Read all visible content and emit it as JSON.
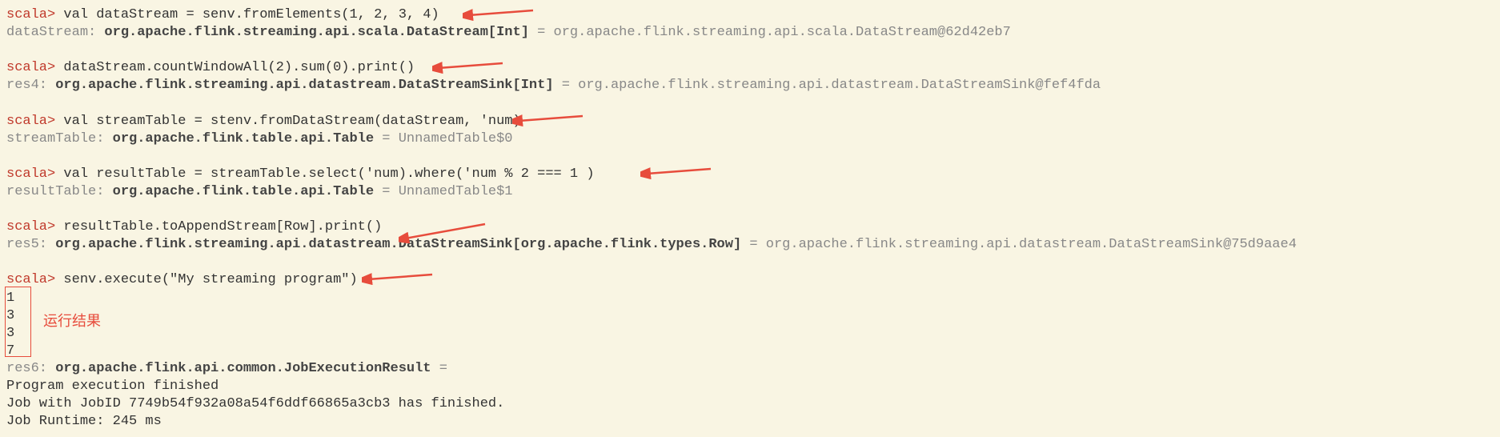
{
  "prompt": "scala>",
  "lines": {
    "l1_cmd": " val dataStream = senv.fromElements(1, 2, 3, 4)",
    "l2_var": "dataStream: ",
    "l2_type": "org.apache.flink.streaming.api.scala.DataStream[Int]",
    "l2_eq": " = ",
    "l2_val": "org.apache.flink.streaming.api.scala.DataStream@62d42eb7",
    "l3_cmd": " dataStream.countWindowAll(2).sum(0).print()",
    "l4_var": "res4: ",
    "l4_type": "org.apache.flink.streaming.api.datastream.DataStreamSink[Int]",
    "l4_eq": " = ",
    "l4_val": "org.apache.flink.streaming.api.datastream.DataStreamSink@fef4fda",
    "l5_cmd": " val streamTable = stenv.fromDataStream(dataStream, 'num)",
    "l6_var": "streamTable: ",
    "l6_type": "org.apache.flink.table.api.Table",
    "l6_eq": " = ",
    "l6_val": "UnnamedTable$0",
    "l7_cmd": " val resultTable = streamTable.select('num).where('num % 2 === 1 )",
    "l8_var": "resultTable: ",
    "l8_type": "org.apache.flink.table.api.Table",
    "l8_eq": " = ",
    "l8_val": "UnnamedTable$1",
    "l9_cmd": " resultTable.toAppendStream[Row].print()",
    "l10_var": "res5: ",
    "l10_type": "org.apache.flink.streaming.api.datastream.DataStreamSink[org.apache.flink.types.Row]",
    "l10_eq": " = ",
    "l10_val": "org.apache.flink.streaming.api.datastream.DataStreamSink@75d9aae4",
    "l11_cmd": " senv.execute(\"My streaming program\")",
    "out1": "1",
    "out2": "3",
    "out3": "3",
    "out4": "7",
    "l12_var": "res6: ",
    "l12_type": "org.apache.flink.api.common.JobExecutionResult",
    "l12_eq": " =",
    "exec1": "Program execution finished",
    "exec2": "Job with JobID 7749b54f932a08a54f6ddf66865a3cb3 has finished.",
    "exec3": "Job Runtime: 245 ms"
  },
  "annotations": {
    "result_label": "运行结果"
  }
}
